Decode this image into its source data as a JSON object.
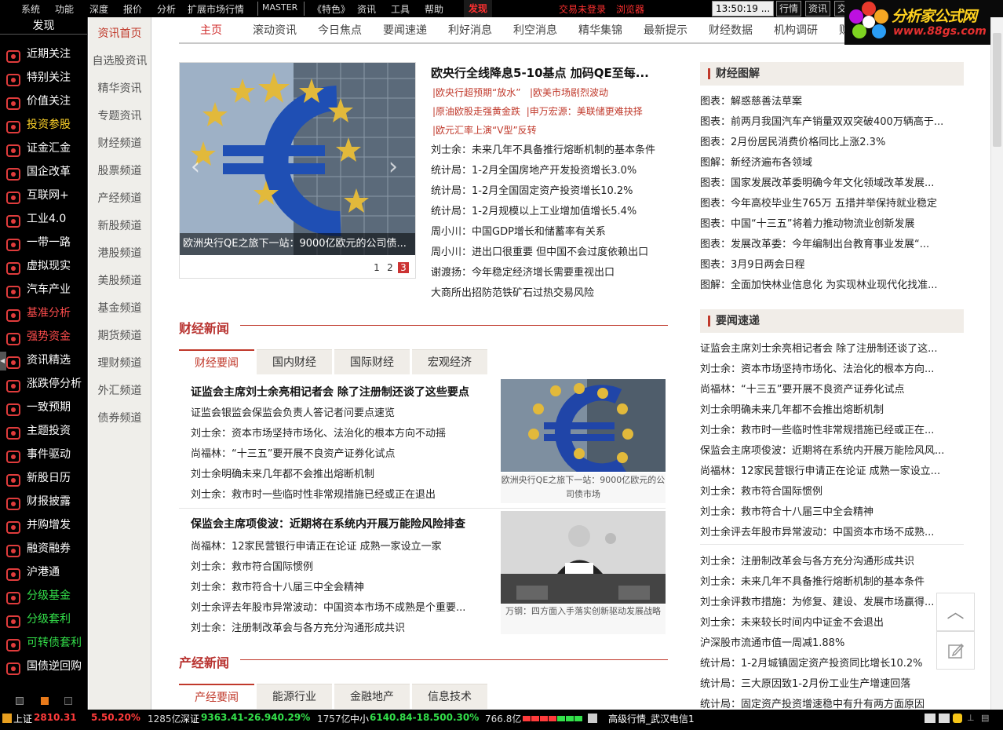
{
  "menubar": {
    "items": [
      "系统",
      "功能",
      "深度",
      "报价",
      "分析",
      "扩展市场行情",
      "MASTER",
      "《特色》",
      "资讯",
      "工具",
      "帮助"
    ],
    "active": "发现",
    "trade_status": "交易未登录",
    "browser": "浏览器",
    "time": "13:50:19 ...",
    "right_tabs": [
      "行情",
      "资讯",
      "交"
    ]
  },
  "logo": {
    "title": "分析家公式网",
    "url": "www.88gs.com"
  },
  "leftpanel": {
    "header": "发现",
    "items": [
      {
        "label": "近期关注",
        "color": "#ffffff",
        "icon": "chart-line-icon"
      },
      {
        "label": "特别关注",
        "color": "#ffffff",
        "icon": "target-icon"
      },
      {
        "label": "价值关注",
        "color": "#ffffff",
        "icon": "briefcase-icon"
      },
      {
        "label": "投资参股",
        "color": "#ffd42a",
        "icon": "umbrella-icon"
      },
      {
        "label": "证金汇金",
        "color": "#ffffff",
        "icon": "person-icon"
      },
      {
        "label": "国企改革",
        "color": "#ffffff",
        "icon": "coins-icon"
      },
      {
        "label": "互联网+",
        "color": "#ffffff",
        "icon": "monitor-icon"
      },
      {
        "label": "工业4.0",
        "color": "#ffffff",
        "icon": "factory-icon"
      },
      {
        "label": "一带一路",
        "color": "#ffffff",
        "icon": "money-bag-icon"
      },
      {
        "label": "虚拟现实",
        "color": "#ffffff",
        "icon": "piggy-bank-icon"
      },
      {
        "label": "汽车产业",
        "color": "#ffffff",
        "icon": "window-icon"
      },
      {
        "label": "基准分析",
        "color": "#ff4d4d",
        "icon": "person-icon"
      },
      {
        "label": "强势资金",
        "color": "#ff4d4d",
        "icon": "briefcase-icon"
      },
      {
        "label": "资讯精选",
        "color": "#ffffff",
        "icon": "document-icon"
      },
      {
        "label": "涨跌停分析",
        "color": "#ffffff",
        "icon": "chart-icon"
      },
      {
        "label": "一致预期",
        "color": "#ffffff",
        "icon": "clock-icon"
      },
      {
        "label": "主题投资",
        "color": "#ffffff",
        "icon": "pie-icon"
      },
      {
        "label": "事件驱动",
        "color": "#ffffff",
        "icon": "gear-icon"
      },
      {
        "label": "新股日历",
        "color": "#ffffff",
        "icon": "bars-icon"
      },
      {
        "label": "财报披露",
        "color": "#ffffff",
        "icon": "chart-line-icon"
      },
      {
        "label": "并购增发",
        "color": "#ffffff",
        "icon": "target-icon"
      },
      {
        "label": "融资融券",
        "color": "#ffffff",
        "icon": "umbrella-icon"
      },
      {
        "label": "沪港通",
        "color": "#ffffff",
        "icon": "person-icon"
      },
      {
        "label": "分级基金",
        "color": "#33e04a",
        "icon": "coins-icon"
      },
      {
        "label": "分级套利",
        "color": "#33e04a",
        "icon": "monitor-icon"
      },
      {
        "label": "可转债套利",
        "color": "#33e04a",
        "icon": "factory-icon"
      },
      {
        "label": "国债逆回购",
        "color": "#ffffff",
        "icon": "money-bag-icon"
      }
    ]
  },
  "subnav": [
    "资讯首页",
    "自选股资讯",
    "精华资讯",
    "专题资讯",
    "财经频道",
    "股票频道",
    "产经频道",
    "新股频道",
    "港股频道",
    "美股频道",
    "基金频道",
    "期货频道",
    "理财频道",
    "外汇频道",
    "债券频道"
  ],
  "topnav": [
    "主页",
    "滚动资讯",
    "今日焦点",
    "要闻速递",
    "利好消息",
    "利空消息",
    "精华集锦",
    "最新提示",
    "财经数据",
    "机构调研",
    "财"
  ],
  "slider": {
    "caption": "欧洲央行QE之旅下一站：9000亿欧元的公司债...",
    "pages": [
      "1",
      "2",
      "3"
    ],
    "current": "3"
  },
  "headline": {
    "title": "欧央行全线降息5-10基点 加码QE至每...",
    "tags": [
      [
        "|欧央行超预期“放水”",
        "|欧美市场剧烈波动"
      ],
      [
        "|原油欧股走强黄金跌",
        "|申万宏源：美联储更难抉择"
      ],
      [
        "|欧元汇率上演“V型”反转"
      ]
    ],
    "items": [
      "刘士余：未来几年不具备推行熔断机制的基本条件",
      "统计局：1-2月全国房地产开发投资增长3.0%",
      "统计局：1-2月全国固定资产投资增长10.2%",
      "统计局：1-2月规模以上工业增加值增长5.4%",
      "周小川：中国GDP增长和储蓄率有关系",
      "周小川：进出口很重要 但中国不会过度依赖出口",
      "谢渡扬：今年稳定经济增长需要重视出口",
      "大商所出招防范铁矿石过热交易风险"
    ]
  },
  "caijing": {
    "title": "财经新闻",
    "tabs": [
      "财经要闻",
      "国内财经",
      "国际财经",
      "宏观经济"
    ],
    "story1": {
      "title": "证监会主席刘士余亮相记者会 除了注册制还谈了这些要点",
      "items": [
        "证监会银监会保监会负责人答记者问要点速览",
        "刘士余：资本市场坚持市场化、法治化的根本方向不动摇",
        "尚福林：“十三五”要开展不良资产证券化试点",
        "刘士余明确未来几年都不会推出熔断机制",
        "刘士余：救市时一些临时性非常规措施已经或正在退出"
      ],
      "thumb_caption": "欧洲央行QE之旅下一站：9000亿欧元的公司债市场"
    },
    "story2": {
      "title": "保监会主席项俊波：近期将在系统内开展万能险风险排查",
      "items": [
        "尚福林：12家民营银行申请正在论证 成熟一家设立一家",
        "刘士余：救市符合国际惯例",
        "刘士余：救市符合十八届三中全会精神",
        "刘士余评去年股市异常波动：中国资本市场不成熟是个重要...",
        "刘士余：注册制改革会与各方充分沟通形成共识"
      ],
      "thumb_caption": "万钢：四方面入手落实创新驱动发展战略"
    }
  },
  "chanjing": {
    "title": "产经新闻",
    "tabs": [
      "产经要闻",
      "能源行业",
      "金融地产",
      "信息技术"
    ]
  },
  "tujie": {
    "title": "财经图解",
    "items": [
      "图表：解惑慈善法草案",
      "图表：前两月我国汽车产销量双双突破400万辆高于...",
      "图表：2月份居民消费价格同比上涨2.3%",
      "图解：新经济遍布各领域",
      "图表：国家发展改革委明确今年文化领域改革发展...",
      "图表：今年高校毕业生765万 五措并举保持就业稳定",
      "图表：中国“十三五”将着力推动物流业创新发展",
      "图表：发展改革委：今年编制出台教育事业发展“...",
      "图表：3月9日两会日程",
      "图解：全面加快林业信息化 为实现林业现代化找准..."
    ]
  },
  "yaowen": {
    "title": "要闻速递",
    "items": [
      "证监会主席刘士余亮相记者会 除了注册制还谈了这...",
      "刘士余：资本市场坚持市场化、法治化的根本方向...",
      "尚福林：“十三五”要开展不良资产证券化试点",
      "刘士余明确未来几年都不会推出熔断机制",
      "刘士余：救市时一些临时性非常规措施已经或正在...",
      "保监会主席项俊波：近期将在系统内开展万能险风风...",
      "尚福林：12家民营银行申请正在论证 成熟一家设立...",
      "刘士余：救市符合国际惯例",
      "刘士余：救市符合十八届三中全会精神",
      "刘士余评去年股市异常波动：中国资本市场不成熟..."
    ],
    "items2": [
      "刘士余：注册制改革会与各方充分沟通形成共识",
      "刘士余：未来几年不具备推行熔断机制的基本条件",
      "刘士余评救市措施：为修复、建设、发展市场赢得...",
      "刘士余：未来较长时间内中证金不会退出",
      "沪深股市流通市值一周减1.88%",
      "统计局：1-2月城镇固定资产投资同比增长10.2%",
      "统计局：三大原因致1-2月份工业生产增速回落",
      "统计局：固定资产投资增速稳中有升有两方面原因"
    ]
  },
  "statusbar": {
    "sh_label": "上证",
    "sh_value": "2810.31",
    "sh_change": "5.50.20%",
    "sh_vol": "1285亿",
    "sz_label": "深证",
    "sz_value": "9363.41-26.940.29%",
    "sz_vol": "1757亿",
    "zx_label": "中小",
    "zx_value": "6140.84-18.500.30%",
    "zx_vol": "766.8亿",
    "text": "高级行情_武汉电信1"
  }
}
